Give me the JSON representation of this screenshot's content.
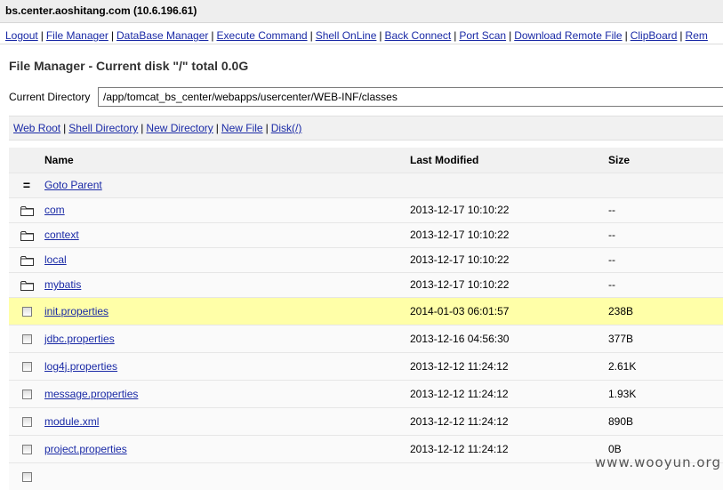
{
  "host": "bs.center.aoshitang.com (10.6.196.61)",
  "nav": [
    "Logout",
    "File Manager",
    "DataBase Manager",
    "Execute Command",
    "Shell OnLine",
    "Back Connect",
    "Port Scan",
    "Download Remote File",
    "ClipBoard",
    "Rem"
  ],
  "title": "File Manager - Current disk \"/\" total 0.0G",
  "current_dir": {
    "label": "Current Directory",
    "value": "/app/tomcat_bs_center/webapps/usercenter/WEB-INF/classes"
  },
  "quick_links": [
    "Web Root",
    "Shell Directory",
    "New Directory",
    "New File",
    "Disk(/)"
  ],
  "table": {
    "headers": {
      "name": "Name",
      "modified": "Last Modified",
      "size": "Size"
    },
    "parent_glyph": "=",
    "parent_label": "Goto Parent",
    "rows": [
      {
        "type": "folder",
        "name": "com",
        "modified": "2013-12-17 10:10:22",
        "size": "--"
      },
      {
        "type": "folder",
        "name": "context",
        "modified": "2013-12-17 10:10:22",
        "size": "--"
      },
      {
        "type": "folder",
        "name": "local",
        "modified": "2013-12-17 10:10:22",
        "size": "--"
      },
      {
        "type": "folder",
        "name": "mybatis",
        "modified": "2013-12-17 10:10:22",
        "size": "--"
      },
      {
        "type": "file",
        "name": "init.properties",
        "modified": "2014-01-03 06:01:57",
        "size": "238B",
        "highlighted": true
      },
      {
        "type": "file",
        "name": "jdbc.properties",
        "modified": "2013-12-16 04:56:30",
        "size": "377B"
      },
      {
        "type": "file",
        "name": "log4j.properties",
        "modified": "2013-12-12 11:24:12",
        "size": "2.61K"
      },
      {
        "type": "file",
        "name": "message.properties",
        "modified": "2013-12-12 11:24:12",
        "size": "1.93K"
      },
      {
        "type": "file",
        "name": "module.xml",
        "modified": "2013-12-12 11:24:12",
        "size": "890B"
      },
      {
        "type": "file",
        "name": "project.properties",
        "modified": "2013-12-12 11:24:12",
        "size": "0B"
      },
      {
        "type": "file",
        "name": "",
        "modified": "",
        "size": ""
      }
    ]
  },
  "watermark": "www.wooyun.org",
  "colors": {
    "link": "#1a2aa6",
    "highlight_row": "#ffffa8",
    "header_bg": "#eeeeee"
  }
}
